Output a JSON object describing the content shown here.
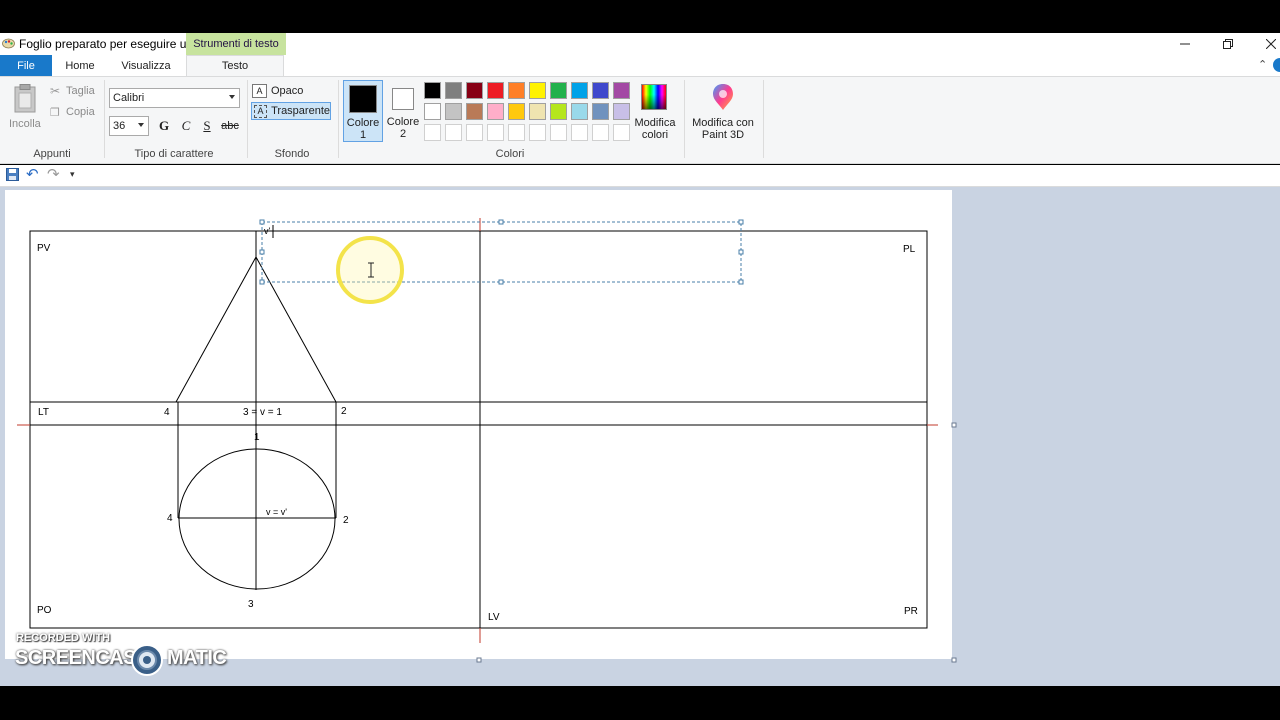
{
  "window": {
    "title": "Foglio preparato per eseguire u...",
    "contextual_tab_header": "Strumenti di testo"
  },
  "tabs": [
    {
      "label": "File"
    },
    {
      "label": "Home"
    },
    {
      "label": "Visualizza"
    },
    {
      "label": "Testo"
    }
  ],
  "ribbon": {
    "clipboard": {
      "paste": "Incolla",
      "cut": "Taglia",
      "copy": "Copia",
      "group_label": "Appunti"
    },
    "font": {
      "family": "Calibri",
      "size": "36",
      "bold": "G",
      "italic": "C",
      "underline": "S",
      "strike": "abc",
      "group_label": "Tipo di carattere"
    },
    "background": {
      "opaque": "Opaco",
      "transparent": "Trasparente",
      "group_label": "Sfondo"
    },
    "colors": {
      "color1_line1": "Colore",
      "color1_line2": "1",
      "color2_line1": "Colore",
      "color2_line2": "2",
      "edit_line1": "Modifica",
      "edit_line2": "colori",
      "paint3d_line1": "Modifica con",
      "paint3d_line2": "Paint 3D",
      "group_label": "Colori",
      "color1_value": "#000000",
      "color2_value": "#ffffff",
      "palette_row1": [
        "#000000",
        "#7f7f7f",
        "#880015",
        "#ed1c24",
        "#ff7f27",
        "#fff200",
        "#22b14c",
        "#00a2e8",
        "#3f48cc",
        "#a349a4"
      ],
      "palette_row2": [
        "#ffffff",
        "#c3c3c3",
        "#b97a57",
        "#ffaec9",
        "#ffc90e",
        "#efe4b0",
        "#b5e61d",
        "#99d9ea",
        "#7092be",
        "#c8bfe7"
      ],
      "palette_row3": [
        "#ffffff",
        "#ffffff",
        "#ffffff",
        "#ffffff",
        "#ffffff",
        "#ffffff",
        "#ffffff",
        "#ffffff",
        "#ffffff",
        "#ffffff"
      ]
    }
  },
  "drawing": {
    "labels": {
      "pv": "PV",
      "pl": "PL",
      "lt": "LT",
      "po": "PO",
      "pr": "PR",
      "lv": "LV",
      "n4_top": "4",
      "n3v1": "3 = v = 1",
      "n2_top": "2",
      "n1": "1",
      "n4_mid": "4",
      "n2_mid": "2",
      "vv": "v = v'",
      "n3": "3",
      "vprime": "v'"
    }
  },
  "watermark": {
    "line1": "RECORDED WITH",
    "left": "SCREENCAST",
    "right": "MATIC"
  }
}
